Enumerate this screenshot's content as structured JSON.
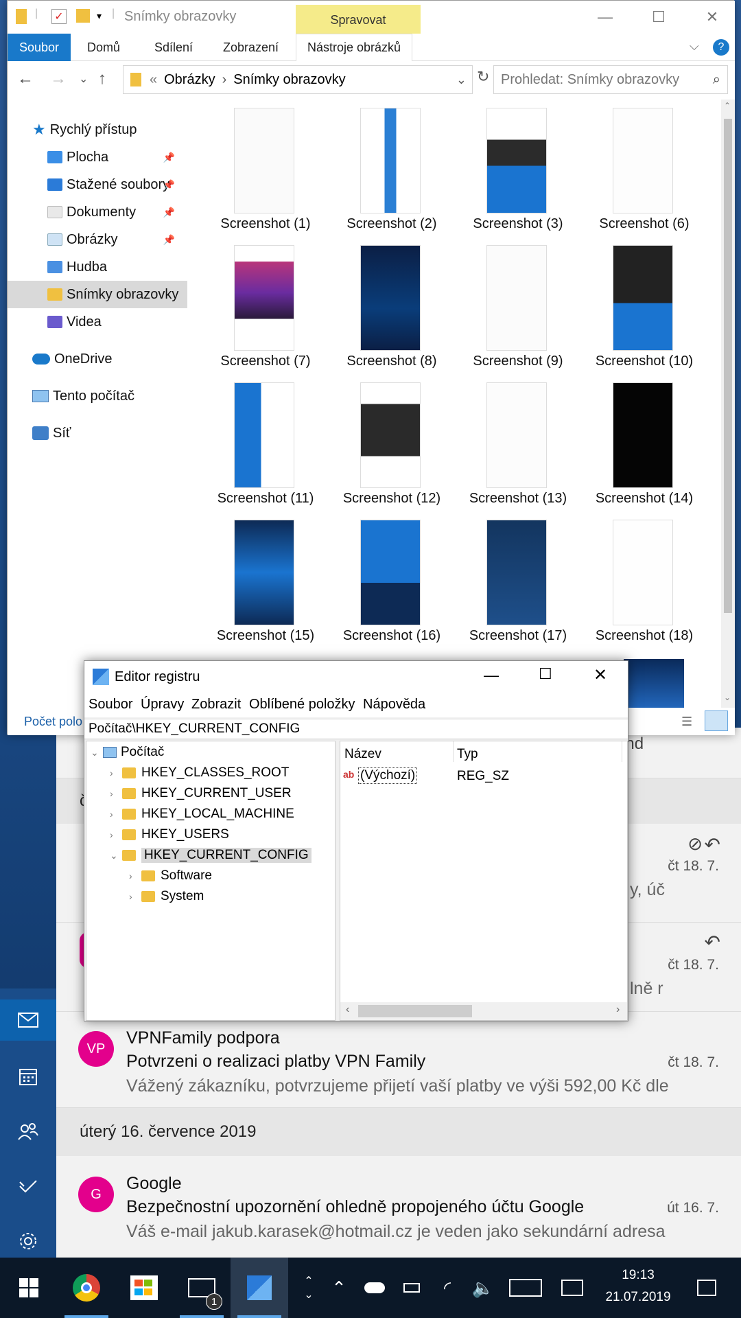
{
  "explorer": {
    "title": "Snímky obrazovky",
    "manage_tab": "Spravovat",
    "ribbon_tabs": [
      "Soubor",
      "Domů",
      "Sdílení",
      "Zobrazení",
      "Nástroje obrázků"
    ],
    "breadcrumb": [
      "Obrázky",
      "Snímky obrazovky"
    ],
    "breadcrumb_prefix": "«",
    "search_placeholder": "Prohledat: Snímky obrazovky",
    "nav": {
      "quick_access": "Rychlý přístup",
      "items": [
        "Plocha",
        "Stažené soubory",
        "Dokumenty",
        "Obrázky",
        "Hudba",
        "Snímky obrazovky",
        "Videa"
      ],
      "onedrive": "OneDrive",
      "this_pc": "Tento počítač",
      "network": "Síť"
    },
    "files": [
      "Screenshot (1)",
      "Screenshot (2)",
      "Screenshot (3)",
      "Screenshot (6)",
      "Screenshot (7)",
      "Screenshot (8)",
      "Screenshot (9)",
      "Screenshot (10)",
      "Screenshot (11)",
      "Screenshot (12)",
      "Screenshot (13)",
      "Screenshot (14)",
      "Screenshot (15)",
      "Screenshot (16)",
      "Screenshot (17)",
      "Screenshot (18)"
    ],
    "status_left": "Počet polo"
  },
  "registry": {
    "title": "Editor registru",
    "menu": [
      "Soubor",
      "Úpravy",
      "Zobrazit",
      "Oblíbené položky",
      "Nápověda"
    ],
    "path": "Počítač\\HKEY_CURRENT_CONFIG",
    "tree_root": "Počítač",
    "hives": [
      "HKEY_CLASSES_ROOT",
      "HKEY_CURRENT_USER",
      "HKEY_LOCAL_MACHINE",
      "HKEY_USERS",
      "HKEY_CURRENT_CONFIG"
    ],
    "subkeys": [
      "Software",
      "System"
    ],
    "columns": [
      "Název",
      "Typ"
    ],
    "value_name": "(Výchozí)",
    "value_type": "REG_SZ",
    "value_icon": "ab"
  },
  "mail": {
    "fragments": {
      "and": "and",
      "c": "č",
      "uc": "y, úč",
      "ne": "lně r"
    },
    "dates_top": [
      "čt 18. 7.",
      "čt 18. 7."
    ],
    "messages": [
      {
        "initials": "VP",
        "sender": "VPNFamily podpora",
        "subject": "Potvrzeni o realizaci platby VPN Family",
        "preview": "Vážený zákazníku, potvrzujeme přijetí vaší platby ve výši 592,00 Kč dle",
        "date": "čt 18. 7."
      }
    ],
    "day_header": "úterý 16. července 2019",
    "message2": {
      "initials": "G",
      "sender": "Google",
      "subject": "Bezpečnostní upozornění ohledně propojeného účtu Google",
      "preview": "Váš e-mail jakub.karasek@hotmail.cz je veden jako sekundární adresa",
      "date": "út 16. 7."
    }
  },
  "taskbar": {
    "time": "19:13",
    "date": "21.07.2019",
    "mail_badge": "1"
  }
}
